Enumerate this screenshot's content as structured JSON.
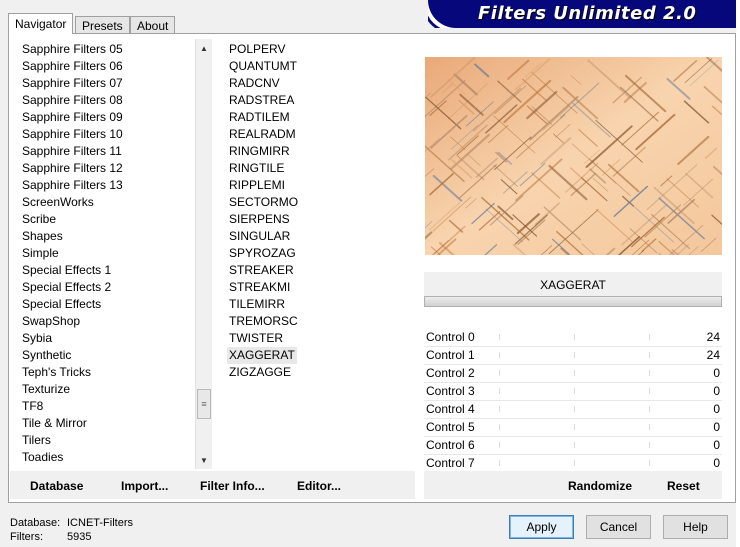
{
  "tabs": [
    {
      "label": "Navigator"
    },
    {
      "label": "Presets"
    },
    {
      "label": "About"
    }
  ],
  "banner": {
    "title": "Filters Unlimited 2.0"
  },
  "categories": [
    "Sapphire Filters 05",
    "Sapphire Filters 06",
    "Sapphire Filters 07",
    "Sapphire Filters 08",
    "Sapphire Filters 09",
    "Sapphire Filters 10",
    "Sapphire Filters 11",
    "Sapphire Filters 12",
    "Sapphire Filters 13",
    "ScreenWorks",
    "Scribe",
    "Shapes",
    "Simple",
    "Special Effects 1",
    "Special Effects 2",
    "Special Effects",
    "SwapShop",
    "Sybia",
    "Synthetic",
    "Teph's Tricks",
    "Texturize",
    "TF8",
    "Tile & Mirror",
    "Tilers",
    "Toadies"
  ],
  "filters": [
    "POLPERV",
    "QUANTUMT",
    "RADCNV",
    "RADSTREA",
    "RADTILEM",
    "REALRADM",
    "RINGMIRR",
    "RINGTILE",
    "RIPPLEMI",
    "SECTORMO",
    "SIERPENS",
    "SINGULAR",
    "SPYROZAG",
    "STREAKER",
    "STREAKMI",
    "TILEMIRR",
    "TREMORSC",
    "TWISTER",
    "XAGGERAT",
    "ZIGZAGGE"
  ],
  "selected_filter_index": 18,
  "left_buttons": {
    "database": "Database",
    "import": "Import...",
    "filter_info": "Filter Info...",
    "editor": "Editor..."
  },
  "right_buttons": {
    "randomize": "Randomize",
    "reset": "Reset"
  },
  "current_filter": "XAGGERAT",
  "controls": [
    {
      "label": "Control 0",
      "value": "24"
    },
    {
      "label": "Control 1",
      "value": "24"
    },
    {
      "label": "Control 2",
      "value": "0"
    },
    {
      "label": "Control 3",
      "value": "0"
    },
    {
      "label": "Control 4",
      "value": "0"
    },
    {
      "label": "Control 5",
      "value": "0"
    },
    {
      "label": "Control 6",
      "value": "0"
    },
    {
      "label": "Control 7",
      "value": "0"
    }
  ],
  "status": {
    "database_label": "Database:",
    "database_value": "ICNET-Filters",
    "filters_label": "Filters:",
    "filters_value": "5935"
  },
  "dialog_buttons": {
    "apply": "Apply",
    "cancel": "Cancel",
    "help": "Help"
  },
  "icons": {
    "scroll_up": "scroll-up-icon",
    "scroll_down": "scroll-down-icon",
    "scroll_thumb": "grip-icon"
  },
  "colors": {
    "banner": "#06077a",
    "preview_base": "#f6d0a8",
    "preview_streak": "#a86c38"
  }
}
